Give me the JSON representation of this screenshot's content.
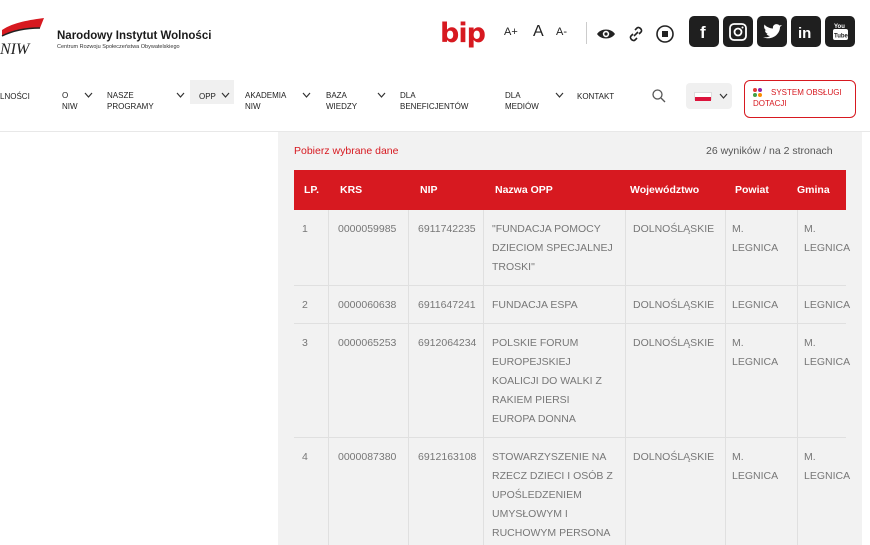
{
  "header": {
    "org_name": "Narodowy Instytut Wolności",
    "org_subtitle": "Centrum Rozwoju Społeczeństwa Obywatelskiego",
    "logo_text": "NIW",
    "bip_label": "bip",
    "font_size_controls": [
      "A+",
      "A",
      "A-"
    ],
    "social_icons": [
      "facebook-icon",
      "instagram-icon",
      "twitter-icon",
      "linkedin-icon",
      "youtube-icon"
    ]
  },
  "nav": {
    "items": [
      {
        "label": "LNOŚCI"
      },
      {
        "label": "O NIW"
      },
      {
        "label": "NASZE PROGRAMY"
      },
      {
        "label": "OPP"
      },
      {
        "label": "AKADEMIA NIW"
      },
      {
        "label": "BAZA WIEDZY"
      },
      {
        "label": "DLA BENEFICJENTÓW"
      },
      {
        "label": "DLA MEDIÓW"
      },
      {
        "label": "KONTAKT"
      }
    ],
    "system_button": "SYSTEM OBSŁUGI DOTACJI"
  },
  "content": {
    "download_label": "Pobierz wybrane dane",
    "results_summary": "26 wyników / na 2 stronach",
    "table": {
      "columns": [
        "LP.",
        "KRS",
        "NIP",
        "Nazwa OPP",
        "Województwo",
        "Powiat",
        "Gmina"
      ],
      "rows": [
        {
          "lp": "1",
          "krs": "0000059985",
          "nip": "6911742235",
          "name": [
            "\"FUNDACJA POMOCY",
            "DZIECIOM SPECJALNEJ",
            "TROSKI\""
          ],
          "woj": "DOLNOŚLĄSKIE",
          "powiat": [
            "M.",
            "LEGNICA"
          ],
          "gmina": [
            "M.",
            "LEGNICA"
          ]
        },
        {
          "lp": "2",
          "krs": "0000060638",
          "nip": "6911647241",
          "name": [
            "FUNDACJA ESPA"
          ],
          "woj": "DOLNOŚLĄSKIE",
          "powiat": [
            "LEGNICA"
          ],
          "gmina": [
            "LEGNICA"
          ]
        },
        {
          "lp": "3",
          "krs": "0000065253",
          "nip": "6912064234",
          "name": [
            "POLSKIE FORUM",
            "EUROPEJSKIEJ",
            "KOALICJI DO WALKI Z",
            "RAKIEM PIERSI",
            "EUROPA DONNA"
          ],
          "woj": "DOLNOŚLĄSKIE",
          "powiat": [
            "M.",
            "LEGNICA"
          ],
          "gmina": [
            "M.",
            "LEGNICA"
          ]
        },
        {
          "lp": "4",
          "krs": "0000087380",
          "nip": "6912163108",
          "name": [
            "STOWARZYSZENIE NA",
            "RZECZ DZIECI I OSÓB Z",
            "UPOŚLEDZENIEM",
            "UMYSŁOWYM I",
            "RUCHOWYM PERSONA"
          ],
          "woj": "DOLNOŚLĄSKIE",
          "powiat": [
            "M.",
            "LEGNICA"
          ],
          "gmina": [
            "M.",
            "LEGNICA"
          ]
        }
      ]
    }
  },
  "colors": {
    "accent": "#d71920",
    "table_bg": "#f2f2f2",
    "social_bg": "#1f1f1f"
  }
}
